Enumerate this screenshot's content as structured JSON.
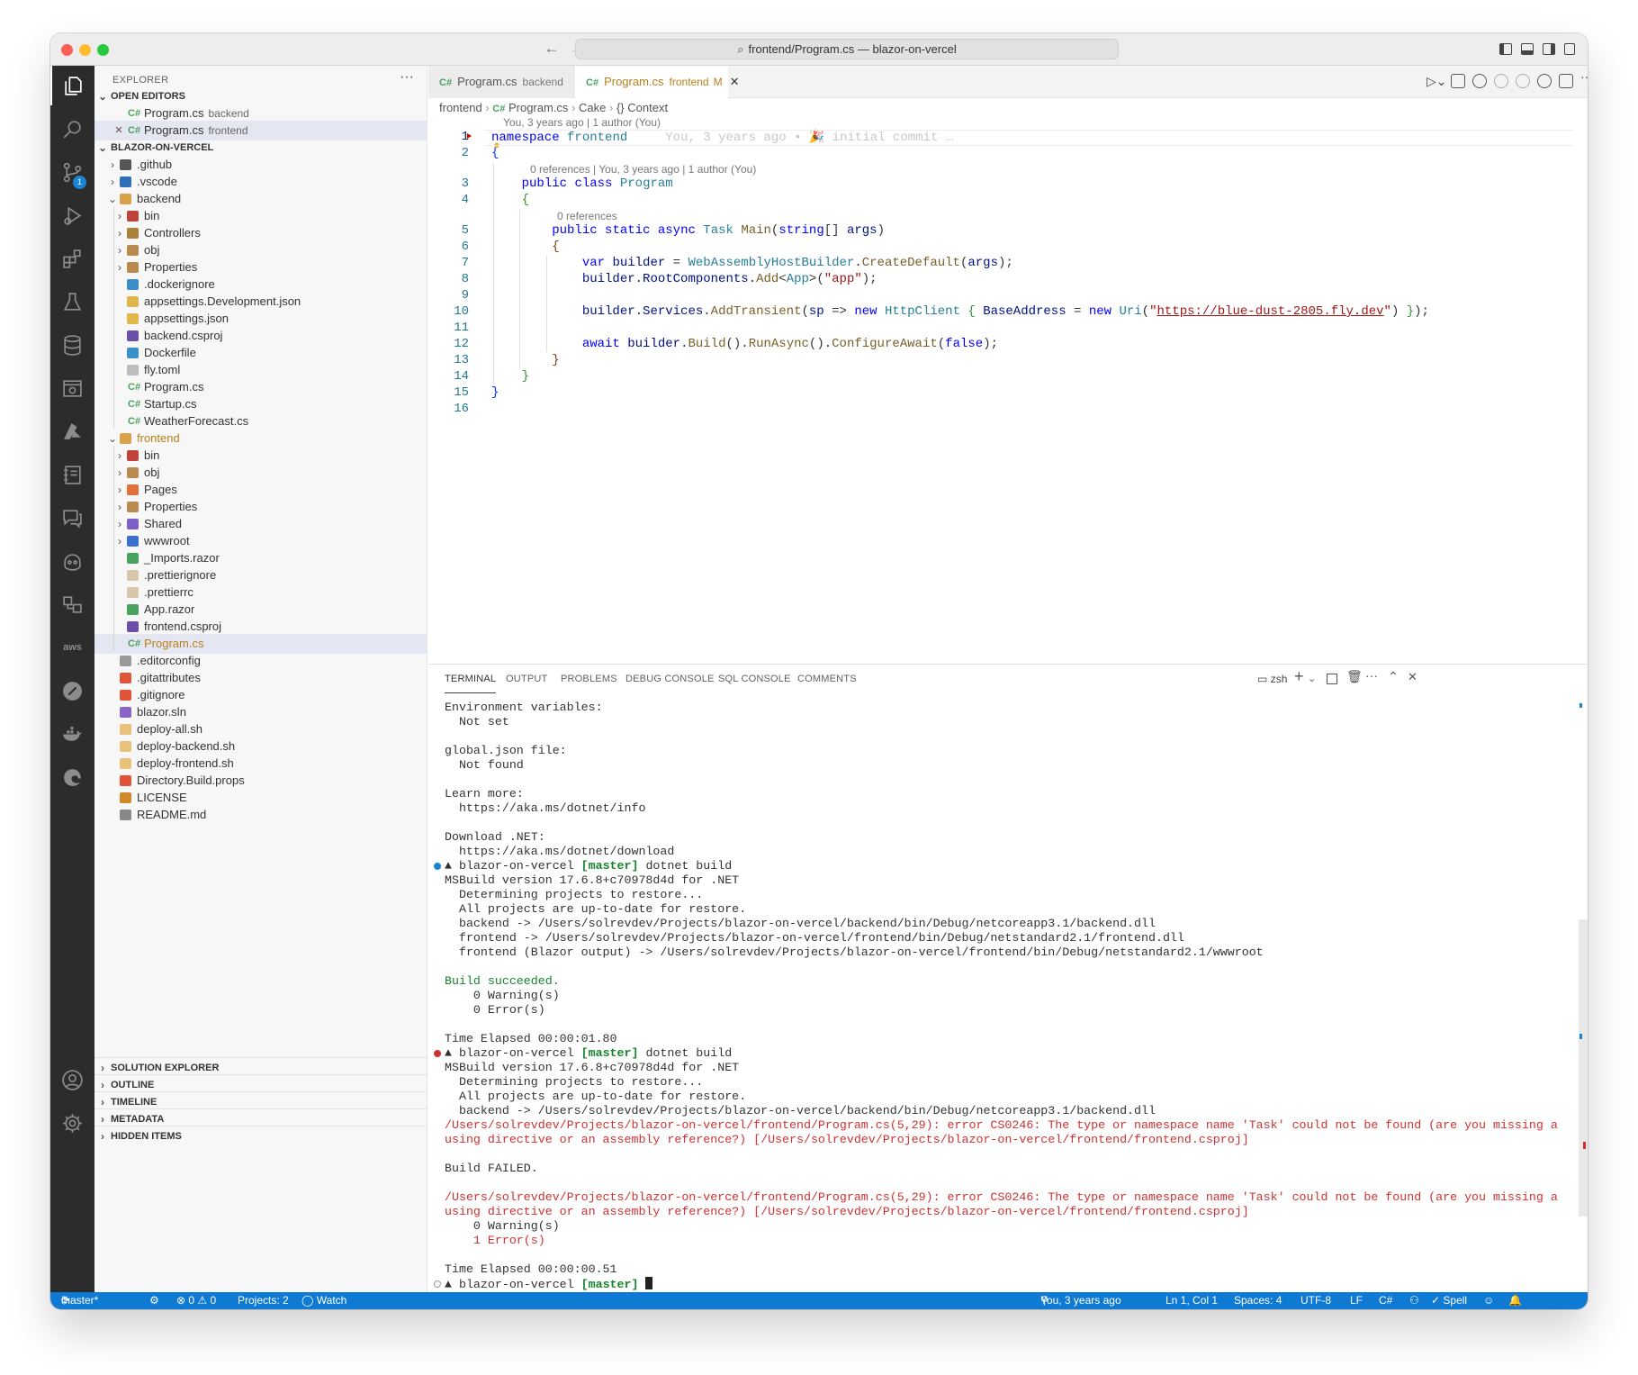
{
  "window": {
    "title": "frontend/Program.cs — blazor-on-vercel",
    "traffic_colors": [
      "#fe5f57",
      "#febc2e",
      "#28c840"
    ]
  },
  "activity_bar": {
    "items": [
      "explorer-icon",
      "search-icon",
      "source-control-icon",
      "run-debug-icon",
      "extensions-icon",
      "testing-icon",
      "database-icon",
      "remote-explorer-icon",
      "azure-icon",
      "notebook-icon",
      "comments-icon",
      "copilot-icon",
      "docker-icon",
      "aws-icon",
      "git-icon",
      "whale-icon",
      "edge-icon"
    ],
    "source_control_badge": "1",
    "aws_label": "aws",
    "accounts_icon": "account-icon",
    "settings_icon": "gear-icon"
  },
  "sidebar": {
    "title": "EXPLORER",
    "more": "···",
    "open_editors_label": "OPEN EDITORS",
    "open_editors": [
      {
        "name": "Program.cs",
        "desc": "backend"
      },
      {
        "name": "Program.cs",
        "desc": "frontend",
        "close": "✕"
      }
    ],
    "root_label": "BLAZOR-ON-VERCEL",
    "tree": [
      {
        "name": ".github",
        "depth": 0,
        "kind": "folder",
        "open": false,
        "icon": "#555555"
      },
      {
        "name": ".vscode",
        "depth": 0,
        "kind": "folder",
        "open": false,
        "icon": "#2e6fb6"
      },
      {
        "name": "backend",
        "depth": 0,
        "kind": "folder",
        "open": true,
        "icon": "#d9a24a"
      },
      {
        "name": "bin",
        "depth": 1,
        "kind": "folder",
        "open": false,
        "icon": "#c0443c"
      },
      {
        "name": "Controllers",
        "depth": 1,
        "kind": "folder",
        "open": false,
        "icon": "#a8833a"
      },
      {
        "name": "obj",
        "depth": 1,
        "kind": "folder",
        "open": false,
        "icon": "#b98a50"
      },
      {
        "name": "Properties",
        "depth": 1,
        "kind": "folder",
        "open": false,
        "icon": "#b98a50"
      },
      {
        "name": ".dockerignore",
        "depth": 1,
        "kind": "file",
        "icon": "#3a8fc9"
      },
      {
        "name": "appsettings.Development.json",
        "depth": 1,
        "kind": "file",
        "icon": "#e1b64a"
      },
      {
        "name": "appsettings.json",
        "depth": 1,
        "kind": "file",
        "icon": "#e1b64a"
      },
      {
        "name": "backend.csproj",
        "depth": 1,
        "kind": "file",
        "icon": "#6b4fa8"
      },
      {
        "name": "Dockerfile",
        "depth": 1,
        "kind": "file",
        "icon": "#3a8fc9"
      },
      {
        "name": "fly.toml",
        "depth": 1,
        "kind": "file",
        "icon": "#bdbdbd"
      },
      {
        "name": "Program.cs",
        "depth": 1,
        "kind": "cs"
      },
      {
        "name": "Startup.cs",
        "depth": 1,
        "kind": "cs"
      },
      {
        "name": "WeatherForecast.cs",
        "depth": 1,
        "kind": "cs"
      },
      {
        "name": "frontend",
        "depth": 0,
        "kind": "folder",
        "open": true,
        "icon": "#d9a24a",
        "modified": true
      },
      {
        "name": "bin",
        "depth": 1,
        "kind": "folder",
        "open": false,
        "icon": "#c0443c"
      },
      {
        "name": "obj",
        "depth": 1,
        "kind": "folder",
        "open": false,
        "icon": "#b98a50"
      },
      {
        "name": "Pages",
        "depth": 1,
        "kind": "folder",
        "open": false,
        "icon": "#e0713b"
      },
      {
        "name": "Properties",
        "depth": 1,
        "kind": "folder",
        "open": false,
        "icon": "#b98a50"
      },
      {
        "name": "Shared",
        "depth": 1,
        "kind": "folder",
        "open": false,
        "icon": "#7d5fc7"
      },
      {
        "name": "wwwroot",
        "depth": 1,
        "kind": "folder",
        "open": false,
        "icon": "#3b6fd0"
      },
      {
        "name": "_Imports.razor",
        "depth": 1,
        "kind": "file",
        "icon": "#48a35f"
      },
      {
        "name": ".prettierignore",
        "depth": 1,
        "kind": "file",
        "icon": "#d8c6a8"
      },
      {
        "name": ".prettierrc",
        "depth": 1,
        "kind": "file",
        "icon": "#d8c6a8"
      },
      {
        "name": "App.razor",
        "depth": 1,
        "kind": "file",
        "icon": "#48a35f"
      },
      {
        "name": "frontend.csproj",
        "depth": 1,
        "kind": "file",
        "icon": "#6b4fa8"
      },
      {
        "name": "Program.cs",
        "depth": 1,
        "kind": "cs",
        "selected": true,
        "modified": true
      },
      {
        "name": ".editorconfig",
        "depth": 0,
        "kind": "file",
        "icon": "#9a9a9a"
      },
      {
        "name": ".gitattributes",
        "depth": 0,
        "kind": "file",
        "icon": "#e0553a"
      },
      {
        "name": ".gitignore",
        "depth": 0,
        "kind": "file",
        "icon": "#e0553a"
      },
      {
        "name": "blazor.sln",
        "depth": 0,
        "kind": "file",
        "icon": "#8a63c8"
      },
      {
        "name": "deploy-all.sh",
        "depth": 0,
        "kind": "file",
        "icon": "#e8c17a"
      },
      {
        "name": "deploy-backend.sh",
        "depth": 0,
        "kind": "file",
        "icon": "#e8c17a"
      },
      {
        "name": "deploy-frontend.sh",
        "depth": 0,
        "kind": "file",
        "icon": "#e8c17a"
      },
      {
        "name": "Directory.Build.props",
        "depth": 0,
        "kind": "file",
        "icon": "#e0553a"
      },
      {
        "name": "LICENSE",
        "depth": 0,
        "kind": "file",
        "icon": "#d08a2a"
      },
      {
        "name": "README.md",
        "depth": 0,
        "kind": "file",
        "icon": "#888888"
      }
    ],
    "bottom_sections": [
      "SOLUTION EXPLORER",
      "OUTLINE",
      "TIMELINE",
      "METADATA",
      "HIDDEN ITEMS"
    ]
  },
  "tabs": [
    {
      "label": "Program.cs",
      "desc": "backend"
    },
    {
      "label": "Program.cs",
      "desc": "frontend",
      "flag": "M",
      "close": "✕"
    }
  ],
  "breadcrumb": [
    "frontend",
    "Program.cs",
    "Cake",
    "{} Context"
  ],
  "editor": {
    "blame_top": "You, 3 years ago | 1 author (You)",
    "ghost_blame": "You, 3 years ago • 🎉 initial commit …",
    "lens_class": "0 references | You, 3 years ago | 1 author (You)",
    "lens_method": "0 references",
    "url": "https://blue-dust-2805.fly.dev",
    "line_numbers": [
      "1",
      "2",
      "3",
      "4",
      "5",
      "6",
      "7",
      "8",
      "9",
      "10",
      "11",
      "12",
      "13",
      "14",
      "15",
      "16"
    ]
  },
  "panel": {
    "tabs": [
      "TERMINAL",
      "OUTPUT",
      "PROBLEMS",
      "DEBUG CONSOLE",
      "SQL CONSOLE",
      "COMMENTS"
    ],
    "shell": "zsh"
  },
  "terminal": {
    "lines": [
      {
        "t": "Environment variables:"
      },
      {
        "t": "  Not set"
      },
      {
        "t": ""
      },
      {
        "t": "global.json file:"
      },
      {
        "t": "  Not found"
      },
      {
        "t": ""
      },
      {
        "t": "Learn more:"
      },
      {
        "t": "  https://aka.ms/dotnet/info"
      },
      {
        "t": ""
      },
      {
        "t": "Download .NET:"
      },
      {
        "t": "  https://aka.ms/dotnet/download"
      },
      {
        "prompt": true,
        "status": "ok",
        "dir": "▲ blazor-on-vercel",
        "branch": "[master]",
        "cmd": " dotnet build"
      },
      {
        "t": "MSBuild version 17.6.8+c70978d4d for .NET"
      },
      {
        "t": "  Determining projects to restore..."
      },
      {
        "t": "  All projects are up-to-date for restore."
      },
      {
        "t": "  backend -> /Users/solrevdev/Projects/blazor-on-vercel/backend/bin/Debug/netcoreapp3.1/backend.dll"
      },
      {
        "t": "  frontend -> /Users/solrevdev/Projects/blazor-on-vercel/frontend/bin/Debug/netstandard2.1/frontend.dll"
      },
      {
        "t": "  frontend (Blazor output) -> /Users/solrevdev/Projects/blazor-on-vercel/frontend/bin/Debug/netstandard2.1/wwwroot"
      },
      {
        "t": ""
      },
      {
        "t": "Build succeeded.",
        "c": "ok"
      },
      {
        "t": "    0 Warning(s)"
      },
      {
        "t": "    0 Error(s)"
      },
      {
        "t": ""
      },
      {
        "t": "Time Elapsed 00:00:01.80"
      },
      {
        "prompt": true,
        "status": "err",
        "dir": "▲ blazor-on-vercel",
        "branch": "[master]",
        "cmd": " dotnet build"
      },
      {
        "t": "MSBuild version 17.6.8+c70978d4d for .NET"
      },
      {
        "t": "  Determining projects to restore..."
      },
      {
        "t": "  All projects are up-to-date for restore."
      },
      {
        "t": "  backend -> /Users/solrevdev/Projects/blazor-on-vercel/backend/bin/Debug/netcoreapp3.1/backend.dll"
      },
      {
        "t": "/Users/solrevdev/Projects/blazor-on-vercel/frontend/Program.cs(5,29): error CS0246: The type or namespace name 'Task' could not be found (are you missing a",
        "c": "err"
      },
      {
        "t": "using directive or an assembly reference?) [/Users/solrevdev/Projects/blazor-on-vercel/frontend/frontend.csproj]",
        "c": "err"
      },
      {
        "t": ""
      },
      {
        "t": "Build FAILED."
      },
      {
        "t": ""
      },
      {
        "t": "/Users/solrevdev/Projects/blazor-on-vercel/frontend/Program.cs(5,29): error CS0246: The type or namespace name 'Task' could not be found (are you missing a",
        "c": "err"
      },
      {
        "t": "using directive or an assembly reference?) [/Users/solrevdev/Projects/blazor-on-vercel/frontend/frontend.csproj]",
        "c": "err"
      },
      {
        "t": "    0 Warning(s)"
      },
      {
        "t": "    1 Error(s)",
        "c": "err"
      },
      {
        "t": ""
      },
      {
        "t": "Time Elapsed 00:00:00.51"
      },
      {
        "prompt": true,
        "status": "idle",
        "dir": "▲ blazor-on-vercel",
        "branch": "[master]",
        "cmd": " ",
        "cursor": true
      }
    ]
  },
  "status_bar": {
    "branch": "master*",
    "errors": "⊗ 0 ⚠ 0",
    "projects": "Projects: 2",
    "watch": "◯ Watch",
    "blame": "You, 3 years ago",
    "position": "Ln 1, Col 1",
    "spaces": "Spaces: 4",
    "encoding": "UTF-8",
    "eol": "LF",
    "language": "C#",
    "spell": "✓ Spell",
    "bg": "#0e7ad4"
  }
}
